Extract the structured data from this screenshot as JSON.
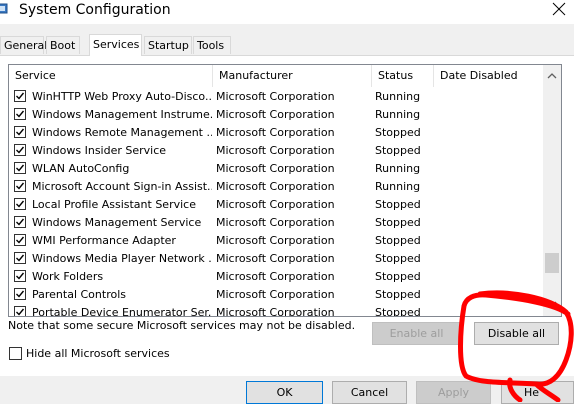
{
  "window": {
    "title": "System Configuration"
  },
  "tabs": [
    "General",
    "Boot",
    "Services",
    "Startup",
    "Tools"
  ],
  "active_tab": "Services",
  "columns": [
    "Service",
    "Manufacturer",
    "Status",
    "Date Disabled"
  ],
  "services": [
    {
      "checked": true,
      "name": "WinHTTP Web Proxy Auto-Disco...",
      "manufacturer": "Microsoft Corporation",
      "status": "Running",
      "date_disabled": ""
    },
    {
      "checked": true,
      "name": "Windows Management Instrume...",
      "manufacturer": "Microsoft Corporation",
      "status": "Running",
      "date_disabled": ""
    },
    {
      "checked": true,
      "name": "Windows Remote Management ...",
      "manufacturer": "Microsoft Corporation",
      "status": "Stopped",
      "date_disabled": ""
    },
    {
      "checked": true,
      "name": "Windows Insider Service",
      "manufacturer": "Microsoft Corporation",
      "status": "Stopped",
      "date_disabled": ""
    },
    {
      "checked": true,
      "name": "WLAN AutoConfig",
      "manufacturer": "Microsoft Corporation",
      "status": "Running",
      "date_disabled": ""
    },
    {
      "checked": true,
      "name": "Microsoft Account Sign-in Assist...",
      "manufacturer": "Microsoft Corporation",
      "status": "Running",
      "date_disabled": ""
    },
    {
      "checked": true,
      "name": "Local Profile Assistant Service",
      "manufacturer": "Microsoft Corporation",
      "status": "Stopped",
      "date_disabled": ""
    },
    {
      "checked": true,
      "name": "Windows Management Service",
      "manufacturer": "Microsoft Corporation",
      "status": "Stopped",
      "date_disabled": ""
    },
    {
      "checked": true,
      "name": "WMI Performance Adapter",
      "manufacturer": "Microsoft Corporation",
      "status": "Stopped",
      "date_disabled": ""
    },
    {
      "checked": true,
      "name": "Windows Media Player Network ...",
      "manufacturer": "Microsoft Corporation",
      "status": "Stopped",
      "date_disabled": ""
    },
    {
      "checked": true,
      "name": "Work Folders",
      "manufacturer": "Microsoft Corporation",
      "status": "Stopped",
      "date_disabled": ""
    },
    {
      "checked": true,
      "name": "Parental Controls",
      "manufacturer": "Microsoft Corporation",
      "status": "Stopped",
      "date_disabled": ""
    },
    {
      "checked": true,
      "name": "Portable Device Enumerator Ser...",
      "manufacturer": "Microsoft Corporation",
      "status": "Stopped",
      "date_disabled": ""
    }
  ],
  "note": "Note that some secure Microsoft services may not be disabled.",
  "buttons": {
    "enable_all": "Enable all",
    "disable_all": "Disable all",
    "ok": "OK",
    "cancel": "Cancel",
    "apply": "Apply",
    "help": "He"
  },
  "hide_ms_services": {
    "label": "Hide all Microsoft services",
    "checked": false
  },
  "icons": {
    "app": "system-config-icon",
    "close": "close-icon",
    "scroll_up": "chevron-up-icon",
    "scroll_down": "chevron-down-icon"
  },
  "colors": {
    "annotation": "#ff0000"
  }
}
